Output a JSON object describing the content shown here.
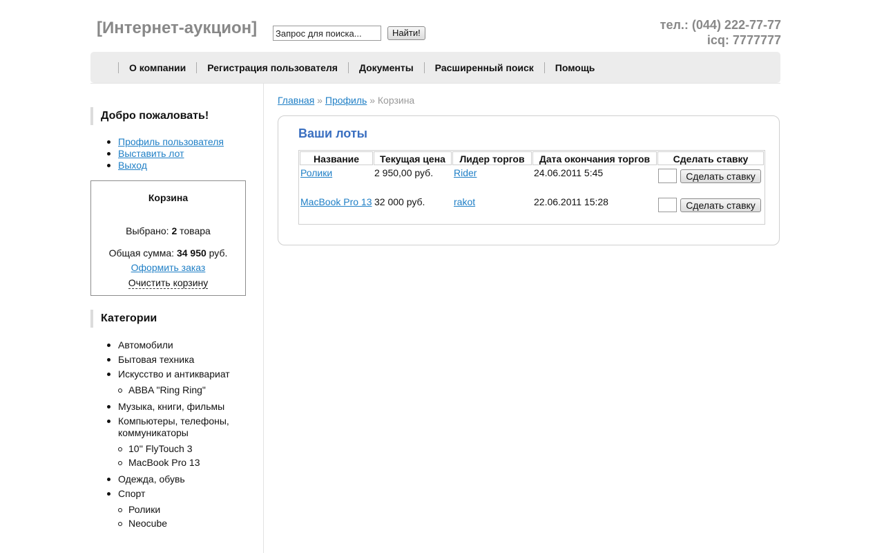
{
  "header": {
    "logo": "[Интернет-аукцион]",
    "search_placeholder": "Запрос для поиска...",
    "search_button": "Найти!",
    "phone": "тел.: (044) 222-77-77",
    "icq": "icq: 7777777"
  },
  "nav": [
    "О компании",
    "Регистрация пользователя",
    "Документы",
    "Расширенный поиск",
    "Помощь"
  ],
  "sidebar": {
    "welcome_title": "Добро пожаловать!",
    "user_links": [
      "Профиль пользователя",
      "Выставить лот",
      "Выход"
    ],
    "cart": {
      "title": "Корзина",
      "selected_label": "Выбрано: ",
      "selected_count": "2",
      "selected_unit": " товара",
      "total_label": "Общая сумма: ",
      "total_value": "34 950",
      "total_unit": " руб.",
      "checkout": "Оформить заказ",
      "clear": "Очистить корзину"
    },
    "categories_title": "Категории",
    "categories": [
      {
        "label": "Автомобили"
      },
      {
        "label": "Бытовая техника"
      },
      {
        "label": "Искусство и антиквариат",
        "children": [
          "ABBA \"Ring Ring\""
        ]
      },
      {
        "label": "Музыка, книги, фильмы"
      },
      {
        "label": "Компьютеры, телефоны, коммуникаторы",
        "children": [
          "10'' FlyTouch 3",
          "MacBook Pro 13"
        ]
      },
      {
        "label": "Одежда, обувь"
      },
      {
        "label": "Спорт",
        "children": [
          "Ролики",
          "Neocube"
        ]
      }
    ]
  },
  "breadcrumb": {
    "home": "Главная",
    "sep": " » ",
    "profile": "Профиль",
    "current": "Корзина"
  },
  "main": {
    "title": "Ваши лоты",
    "columns": [
      "Название",
      "Текущая цена",
      "Лидер торгов",
      "Дата окончания торгов",
      "Сделать ставку"
    ],
    "rows": [
      {
        "name": "Ролики",
        "price": "2 950,00 руб.",
        "leader": "Rider",
        "end": "24.06.2011 5:45",
        "button": "Сделать ставку"
      },
      {
        "name": "MacBook Pro 13",
        "price": "32 000 руб.",
        "leader": "rakot",
        "end": "22.06.2011 15:28",
        "button": "Сделать ставку"
      }
    ]
  }
}
